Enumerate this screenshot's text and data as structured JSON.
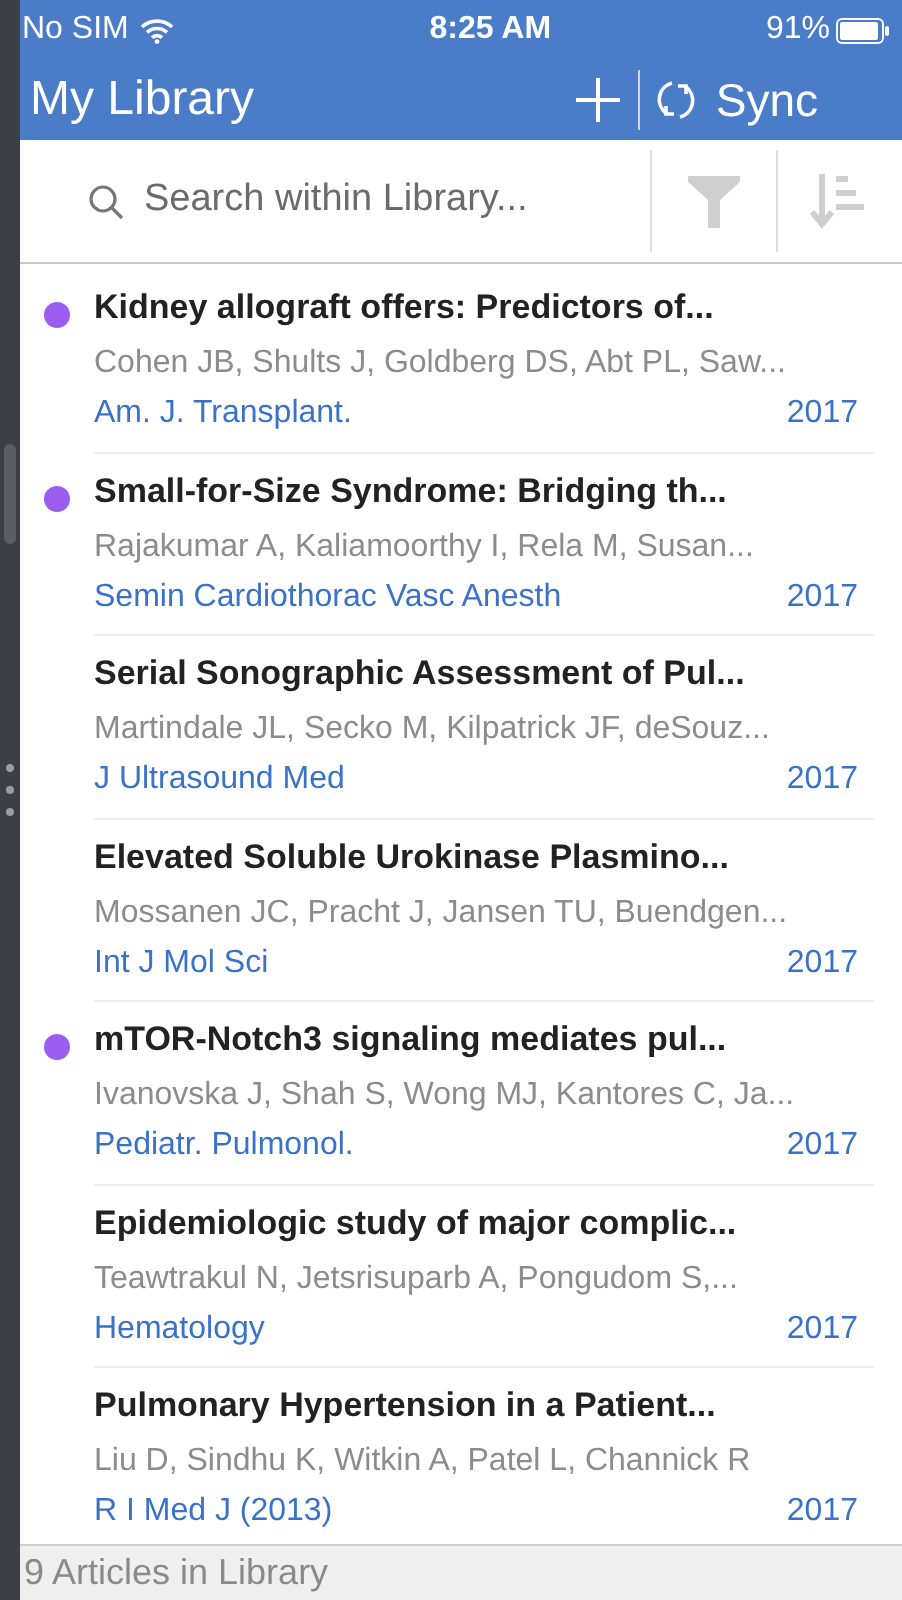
{
  "status_bar": {
    "carrier": "No SIM",
    "time": "8:25 AM",
    "battery": "91%"
  },
  "header": {
    "title": "My Library",
    "sync_label": "Sync"
  },
  "search": {
    "placeholder": "Search within Library..."
  },
  "articles": [
    {
      "title": "Kidney allograft offers: Predictors of...",
      "authors": "Cohen JB, Shults J, Goldberg DS, Abt PL, Saw...",
      "journal": "Am. J. Transplant.",
      "year": "2017",
      "unread": true
    },
    {
      "title": "Small-for-Size Syndrome: Bridging th...",
      "authors": "Rajakumar A, Kaliamoorthy I, Rela M, Susan...",
      "journal": "Semin Cardiothorac Vasc Anesth",
      "year": "2017",
      "unread": true
    },
    {
      "title": "Serial Sonographic Assessment of Pul...",
      "authors": "Martindale JL, Secko M, Kilpatrick JF, deSouz...",
      "journal": "J Ultrasound Med",
      "year": "2017",
      "unread": false
    },
    {
      "title": "Elevated Soluble Urokinase Plasmino...",
      "authors": "Mossanen JC, Pracht J, Jansen TU, Buendgen...",
      "journal": "Int J Mol Sci",
      "year": "2017",
      "unread": false
    },
    {
      "title": "mTOR-Notch3 signaling mediates pul...",
      "authors": "Ivanovska J, Shah S, Wong MJ, Kantores C, Ja...",
      "journal": "Pediatr. Pulmonol.",
      "year": "2017",
      "unread": true
    },
    {
      "title": "Epidemiologic study of major complic...",
      "authors": "Teawtrakul N, Jetsrisuparb A, Pongudom S,...",
      "journal": "Hematology",
      "year": "2017",
      "unread": false
    },
    {
      "title": "Pulmonary Hypertension in a Patient...",
      "authors": "Liu D, Sindhu K, Witkin A, Patel L, Channick R",
      "journal": "R I Med J (2013)",
      "year": "2017",
      "unread": false
    }
  ],
  "footer": {
    "count": "9 Articles in Library"
  }
}
